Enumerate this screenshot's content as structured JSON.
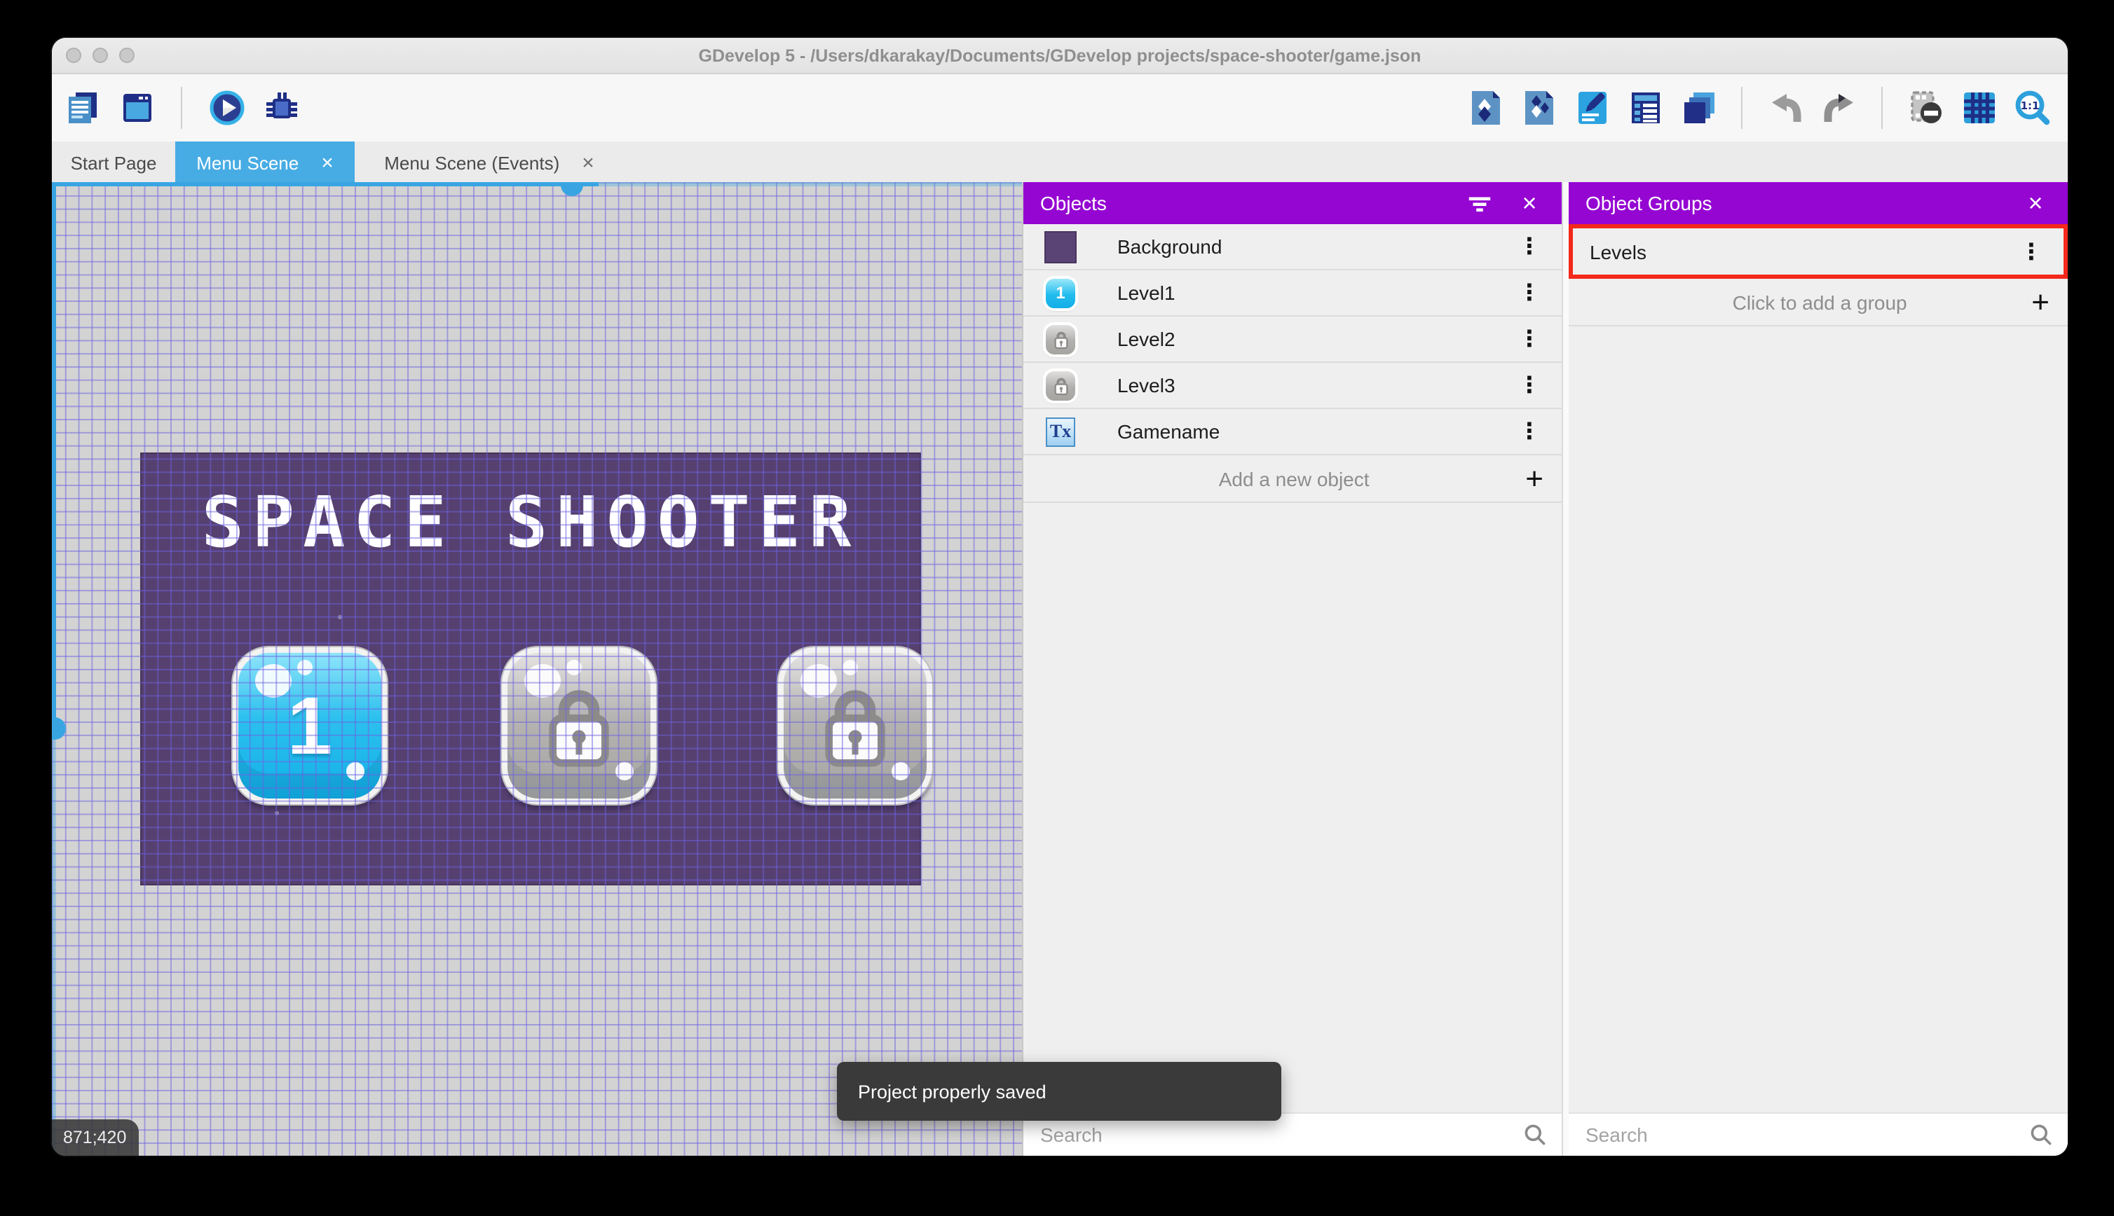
{
  "window": {
    "title": "GDevelop 5 - /Users/dkarakay/Documents/GDevelop projects/space-shooter/game.json"
  },
  "tabs": [
    {
      "label": "Start Page"
    },
    {
      "label": "Menu Scene"
    },
    {
      "label": "Menu Scene (Events)"
    }
  ],
  "canvas": {
    "coordinates": "871;420",
    "game": {
      "title": "SPACE SHOOTER",
      "level_buttons": [
        {
          "label": "1",
          "locked": false
        },
        {
          "label": "",
          "locked": true
        },
        {
          "label": "",
          "locked": true
        }
      ]
    }
  },
  "objects_panel": {
    "title": "Objects",
    "items": [
      {
        "name": "Background",
        "thumb": "purple-swatch",
        "thumb_label": ""
      },
      {
        "name": "Level1",
        "thumb": "blue-button",
        "thumb_label": "1"
      },
      {
        "name": "Level2",
        "thumb": "locked-button",
        "thumb_label": ""
      },
      {
        "name": "Level3",
        "thumb": "locked-button",
        "thumb_label": ""
      },
      {
        "name": "Gamename",
        "thumb": "text-object",
        "thumb_label": ""
      }
    ],
    "add_label": "Add a new object",
    "search_placeholder": "Search"
  },
  "groups_panel": {
    "title": "Object Groups",
    "groups": [
      {
        "name": "Levels"
      }
    ],
    "add_label": "Click to add a group",
    "search_placeholder": "Search"
  },
  "toast": {
    "message": "Project properly saved"
  },
  "icons": {
    "close": "×",
    "plus": "+",
    "kebab": "⋮",
    "text_object": "Tx",
    "filter": "filter-list",
    "search": "magnifier"
  },
  "colors": {
    "panel_header": "#9506d2",
    "active_tab": "#47ace4",
    "annotation": "#f4281b",
    "game_background": "#564070",
    "grid_line": "#6c62e0"
  }
}
